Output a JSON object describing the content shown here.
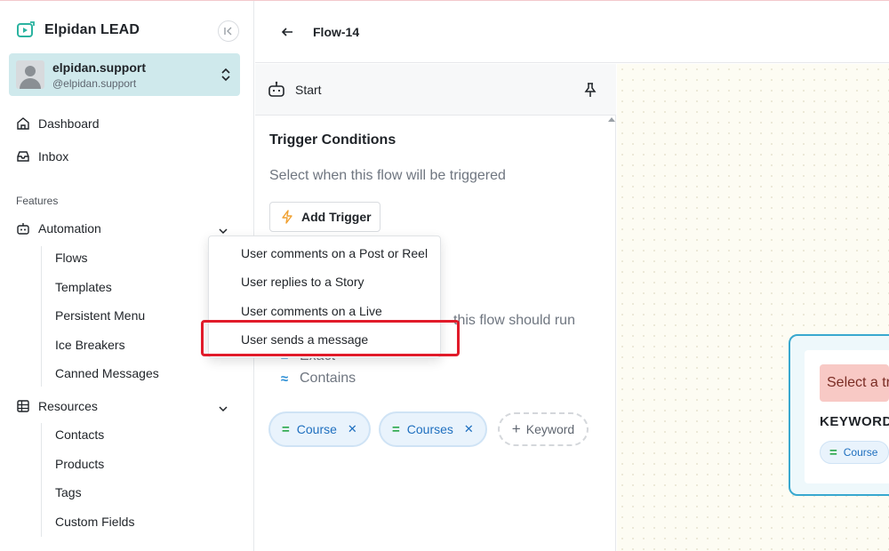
{
  "app": {
    "name": "Elpidan LEAD"
  },
  "account": {
    "name": "elpidan.support",
    "handle": "@elpidan.support"
  },
  "nav": {
    "dashboard": "Dashboard",
    "inbox": "Inbox",
    "features_label": "Features",
    "automation": "Automation",
    "automation_items": [
      "Flows",
      "Templates",
      "Persistent Menu",
      "Ice Breakers",
      "Canned Messages"
    ],
    "resources": "Resources",
    "resources_items": [
      "Contacts",
      "Products",
      "Tags",
      "Custom Fields"
    ]
  },
  "header": {
    "title": "Flow-14"
  },
  "panel": {
    "node_label": "Start",
    "trigger_title": "Trigger Conditions",
    "trigger_subtitle": "Select when this flow will be triggered",
    "add_trigger_label": "Add Trigger",
    "partial_text": "this flow should run",
    "match_options": [
      {
        "symbol": "=",
        "label": "Exact"
      },
      {
        "symbol": "≈",
        "label": "Contains"
      }
    ],
    "keywords": [
      "Course",
      "Courses"
    ],
    "add_keyword_label": "Keyword"
  },
  "dropdown": {
    "items": [
      "User comments on a Post or Reel",
      "User replies to a Story",
      "User comments on a Live",
      "User sends a message"
    ],
    "highlighted_index": 3
  },
  "canvas_node": {
    "warning": "Select a tr",
    "keywords_heading": "KEYWORD",
    "keyword_chip": "Course"
  },
  "colors": {
    "accent": "#38a8cf",
    "account_bg": "#cfe9ec",
    "highlight": "#e11b2a",
    "chip_text": "#1e6fbf"
  }
}
